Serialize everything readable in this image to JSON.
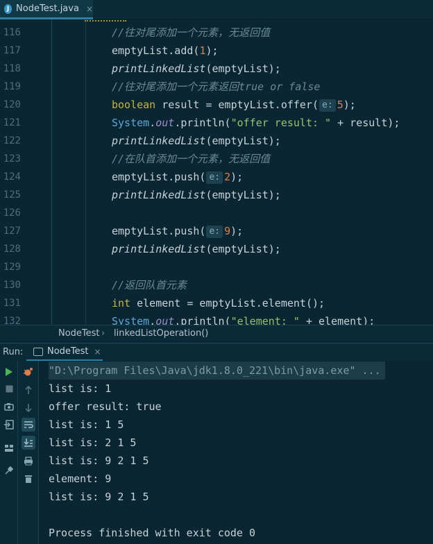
{
  "editor_tab": {
    "icon_letter": "J",
    "file_name": "NodeTest.java",
    "close": "×"
  },
  "code_lines": [
    {
      "num": "116",
      "html": "<span class=\"cm\">//往对尾添加一个元素，无返回值</span>"
    },
    {
      "num": "117",
      "html": "emptyList.add(<span class=\"num\">1</span>);"
    },
    {
      "num": "118",
      "html": "<span class=\"it\">printLinkedList</span>(emptyList);"
    },
    {
      "num": "119",
      "html": "<span class=\"cm\">//往对尾添加一个元素返回true or false</span>"
    },
    {
      "num": "120",
      "html": "<span class=\"kw\">boolean</span> result = emptyList.offer(<span class=\"hint\">e:</span><span class=\"num\">5</span>);"
    },
    {
      "num": "121",
      "html": "<span class=\"sys\">System</span>.<span class=\"fld\">out</span>.println(<span class=\"str\">\"offer result: \"</span> + result);"
    },
    {
      "num": "122",
      "html": "<span class=\"it\">printLinkedList</span>(emptyList);"
    },
    {
      "num": "123",
      "html": "<span class=\"cm\">//在队首添加一个元素，无返回值</span>"
    },
    {
      "num": "124",
      "html": "emptyList.push(<span class=\"hint\">e:</span><span class=\"num\">2</span>);"
    },
    {
      "num": "125",
      "html": "<span class=\"it\">printLinkedList</span>(emptyList);"
    },
    {
      "num": "126",
      "html": ""
    },
    {
      "num": "127",
      "html": "emptyList.push(<span class=\"hint\">e:</span><span class=\"num\">9</span>);"
    },
    {
      "num": "128",
      "html": "<span class=\"it\">printLinkedList</span>(emptyList);"
    },
    {
      "num": "129",
      "html": ""
    },
    {
      "num": "130",
      "html": "<span class=\"cm\">//返回队首元素</span>"
    },
    {
      "num": "131",
      "html": "<span class=\"kw\">int</span> element = emptyList.element();"
    },
    {
      "num": "132",
      "html": "<span class=\"sys\">System</span>.<span class=\"fld\">out</span>.println(<span class=\"str\">\"element: \"</span> + element);"
    }
  ],
  "breadcrumb": {
    "class_name": "NodeTest",
    "separator": "›",
    "method": "linkedListOperation()"
  },
  "run_panel": {
    "label": "Run:",
    "tab_name": "NodeTest",
    "tab_close": "×"
  },
  "console_lines": [
    "\"D:\\Program Files\\Java\\jdk1.8.0_221\\bin\\java.exe\" ...",
    "list is: 1",
    "offer result: true",
    "list is: 1 5",
    "list is: 2 1 5",
    "list is: 9 2 1 5",
    "element: 9",
    "list is: 9 2 1 5",
    "",
    "Process finished with exit code 0"
  ],
  "toolbar_icons": {
    "left": [
      "run-icon",
      "stop-icon",
      "camera-icon",
      "login-icon",
      "layout-icon",
      "pin-icon"
    ],
    "right": [
      "debug-icon",
      "up-arrow-icon",
      "down-arrow-icon",
      "soft-wrap-icon",
      "scroll-to-end-icon",
      "print-icon",
      "trash-icon"
    ]
  },
  "colors": {
    "background": "#0a2633",
    "accent": "#2f7fa4",
    "keyword": "#c7b445",
    "number": "#e47c49",
    "string": "#99c36b",
    "comment": "#6a8a98"
  }
}
